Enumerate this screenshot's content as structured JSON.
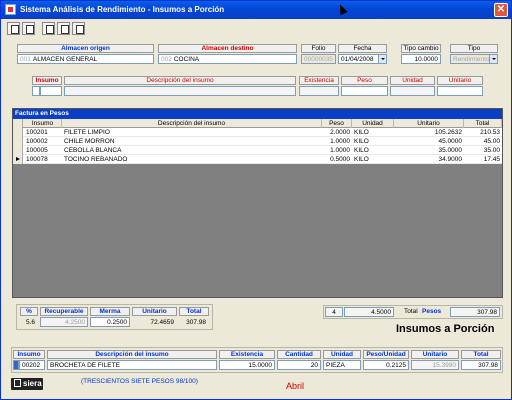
{
  "window": {
    "title": "Sistema Análisis de Rendimiento - Insumos a Porción",
    "close_glyph": "✕"
  },
  "header": {
    "almacen_origen_label": "Almacen origen",
    "almacen_origen_code": "001",
    "almacen_origen_value": "ALMACEN GENERAL",
    "almacen_destino_label": "Almacen destino",
    "almacen_destino_code": "002",
    "almacen_destino_value": "COCINA",
    "folio_label": "Folio",
    "folio_value": "00000035",
    "fecha_label": "Fecha",
    "fecha_value": "01/04/2008",
    "tipo_cambio_label": "Tipo cambio",
    "tipo_cambio_value": "10.0000",
    "tipo_label": "Tipo",
    "tipo_value": "Rendimiento"
  },
  "insumo_header": {
    "insumo_label": "Insumo",
    "descripcion_label": "Descripción del insumo",
    "existencia_label": "Existencia",
    "peso_label": "Peso",
    "unidad_label": "Unidad",
    "unitario_label": "Unitario"
  },
  "grid": {
    "title": "Factura en Pesos",
    "columns": [
      "Insumo",
      "Descripción del insumo",
      "Peso",
      "Unidad",
      "Unitario",
      "Total"
    ],
    "rows": [
      {
        "insumo": "100201",
        "descripcion": "FILETE LIMPIO",
        "peso": "2.0000",
        "unidad": "KILO",
        "unitario": "105.2632",
        "total": "210.53"
      },
      {
        "insumo": "100002",
        "descripcion": "CHILE MORRON",
        "peso": "1.0000",
        "unidad": "KILO",
        "unitario": "45.0000",
        "total": "45.00"
      },
      {
        "insumo": "100005",
        "descripcion": "CEBOLLA BLANCA",
        "peso": "1.0000",
        "unidad": "KILO",
        "unitario": "35.0000",
        "total": "35.00"
      },
      {
        "insumo": "100078",
        "descripcion": "TOCINO REBANADO",
        "peso": "0.5000",
        "unidad": "KILO",
        "unitario": "34.9000",
        "total": "17.45"
      }
    ]
  },
  "summary": {
    "pct_label": "%",
    "pct_value": "5.6",
    "recuperable_label": "Recuperable",
    "recuperable_value": "4.2500",
    "merma_label": "Merma",
    "merma_value": "0.2500",
    "unitario_label": "Unitario",
    "unitario_value": "72.4659",
    "total_label": "Total",
    "total_value": "307.98"
  },
  "totals": {
    "count": "4",
    "peso_total": "4.5000",
    "total_label": "Total",
    "currency": "Pesos",
    "amount": "307.98"
  },
  "module_title": "Insumos a Porción",
  "bottom": {
    "insumo_label": "Insumo",
    "descripcion_label": "Descripción del insumo",
    "existencia_label": "Existencia",
    "cantidad_label": "Cantidad",
    "unidad_label": "Unidad",
    "peso_unidad_label": "Peso/Unidad",
    "unitario_label": "Unitario",
    "total_label": "Total",
    "insumo_value": "00202",
    "descripcion_value": "BROCHETA DE FILETE",
    "existencia_value": "15.0000",
    "cantidad_value": "20",
    "unidad_value": "PIEZA",
    "peso_unidad_value": "0.2125",
    "unitario_value": "15.3990",
    "total_value": "307.98"
  },
  "logo_text": "siera",
  "amount_in_words": "(TRESCIENTOS SIETE PESOS 98/100)",
  "month": "Abril"
}
